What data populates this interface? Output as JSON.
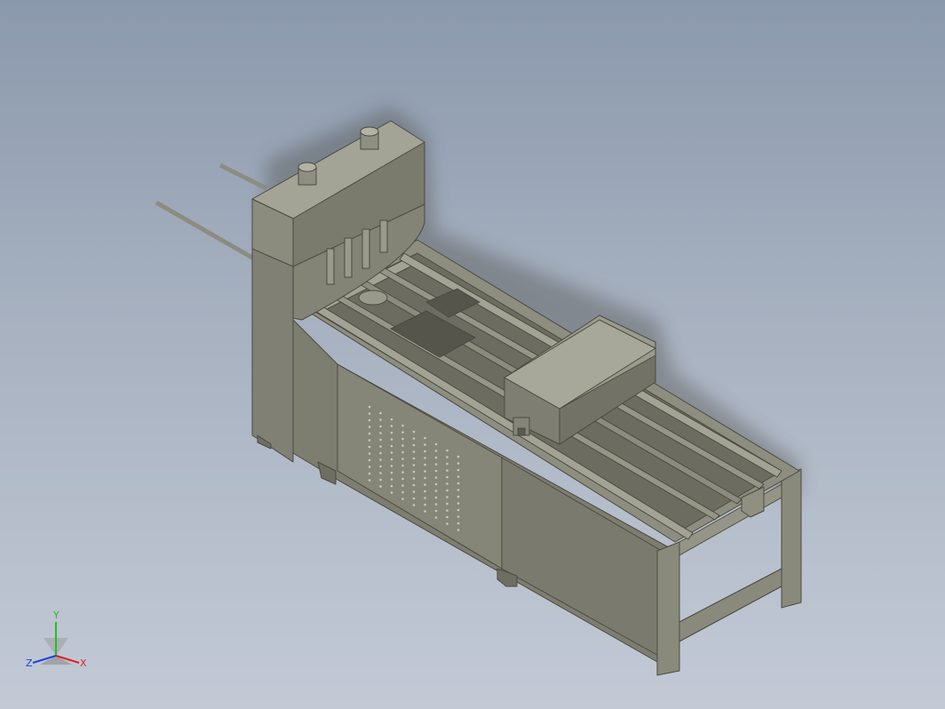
{
  "model": {
    "description_hidden": "",
    "colors": {
      "bg_top": "#8b99ad",
      "bg_bottom": "#c3cad6",
      "body_front": "#8a8a7c",
      "body_side": "#707064",
      "body_top": "#9e9e90",
      "edge": "#4a4a40",
      "shadow": "#3c3c34",
      "rail": "#a3a395",
      "axis_x": "#e02020",
      "axis_y": "#20c020",
      "axis_z": "#2040e0"
    }
  },
  "triad": {
    "x_label": "X",
    "y_label": "Y",
    "z_label": "Z"
  }
}
